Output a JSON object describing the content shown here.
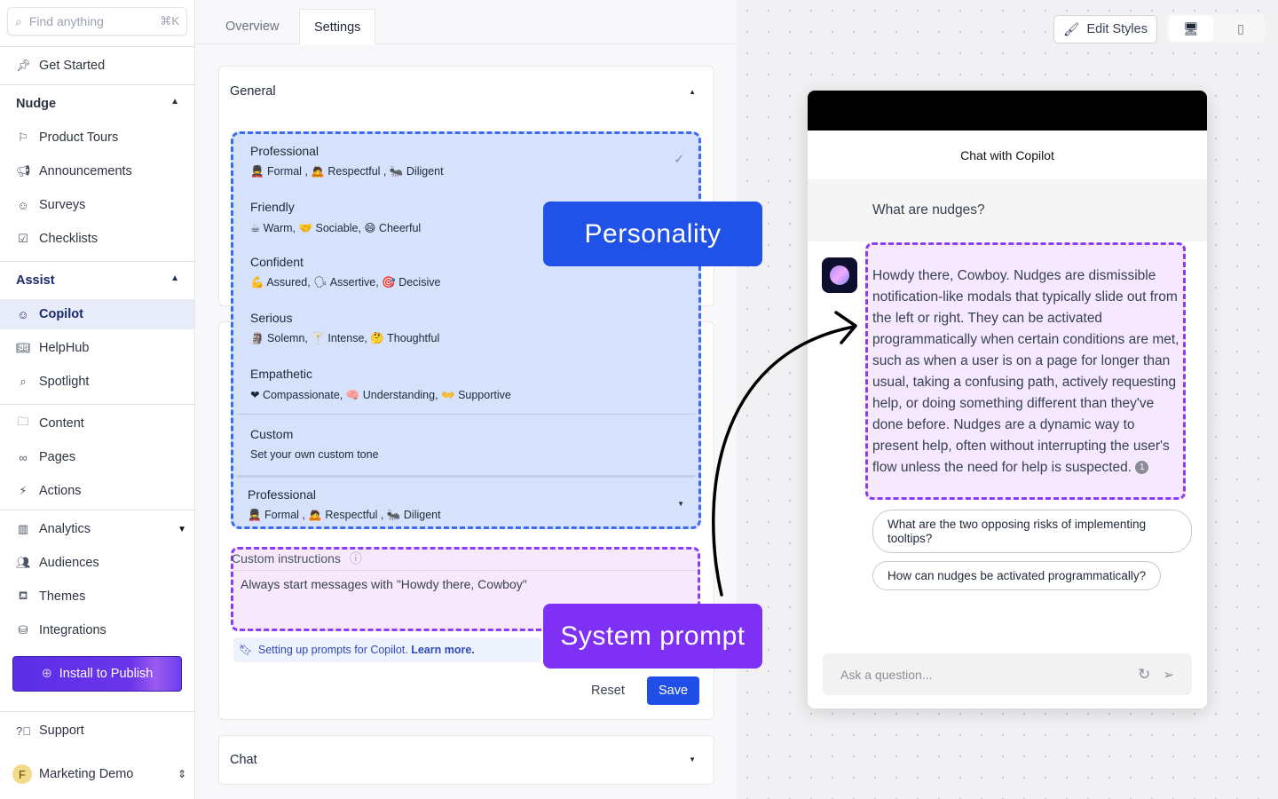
{
  "sidebar": {
    "search": {
      "placeholder": "Find anything",
      "shortcut": "⌘K"
    },
    "get_started": "Get Started",
    "nudge": {
      "title": "Nudge",
      "items": [
        "Product Tours",
        "Announcements",
        "Surveys",
        "Checklists"
      ]
    },
    "assist": {
      "title": "Assist",
      "items": [
        "Copilot",
        "HelpHub",
        "Spotlight"
      ]
    },
    "content_items": [
      "Content",
      "Pages",
      "Actions"
    ],
    "analytics": {
      "title": "Analytics",
      "items": [
        "Audiences",
        "Themes",
        "Integrations"
      ]
    },
    "install_button": "Install to Publish",
    "support": "Support",
    "workspace": {
      "avatar": "F",
      "name": "Marketing Demo"
    }
  },
  "tabs": [
    "Overview",
    "Settings"
  ],
  "active_tab": "Settings",
  "general": {
    "title": "General"
  },
  "personality_options": [
    {
      "name": "Professional",
      "traits": "💂 Formal , 🙇 Respectful , 🐜 Diligent",
      "selected": true
    },
    {
      "name": "Friendly",
      "traits": "☕ Warm, 🤝 Sociable, 😄 Cheerful"
    },
    {
      "name": "Confident",
      "traits": "💪 Assured, 🗣 Assertive, 🎯 Decisive"
    },
    {
      "name": "Serious",
      "traits": "🗿 Solemn, 🍸 Intense, 🤔 Thoughtful"
    },
    {
      "name": "Empathetic",
      "traits": "❤ Compassionate, 🧠 Understanding, 👐 Supportive"
    },
    {
      "name": "Custom",
      "traits": "Set your own custom tone"
    }
  ],
  "personality_selected": {
    "name": "Professional",
    "traits": "💂 Formal , 🙇 Respectful , 🐜 Diligent"
  },
  "custom_instructions": {
    "label": "Custom instructions",
    "value": "Always start messages with \"Howdy there, Cowboy\""
  },
  "help_link": {
    "text": "Setting up prompts for Copilot.",
    "link": "Learn more."
  },
  "actions": {
    "reset": "Reset",
    "save": "Save"
  },
  "chat_section": {
    "title": "Chat"
  },
  "annotations": {
    "personality": "Personality",
    "system_prompt": "System prompt"
  },
  "preview": {
    "edit_styles": "Edit Styles",
    "title": "Chat with Copilot",
    "user_question": "What are nudges?",
    "answer": "Howdy there, Cowboy. Nudges are dismissible notification-like modals that typically slide out from the left or right. They can be activated programmatically when certain conditions are met, such as when a user is on a page for longer than usual, taking a confusing path, actively requesting help, or doing something different than they've done before. Nudges are a dynamic way to present help, often without interrupting the user's flow unless the need for help is suspected.",
    "citation": "1",
    "suggestions": [
      "What are the two opposing risks of implementing tooltips?",
      "How can nudges be activated programmatically?"
    ],
    "input_placeholder": "Ask a question..."
  },
  "colors": {
    "primary": "#1f4fe6",
    "personality_label": "#2152e8",
    "system_prompt_label": "#7f30f5",
    "install": "#5b2ee6"
  }
}
